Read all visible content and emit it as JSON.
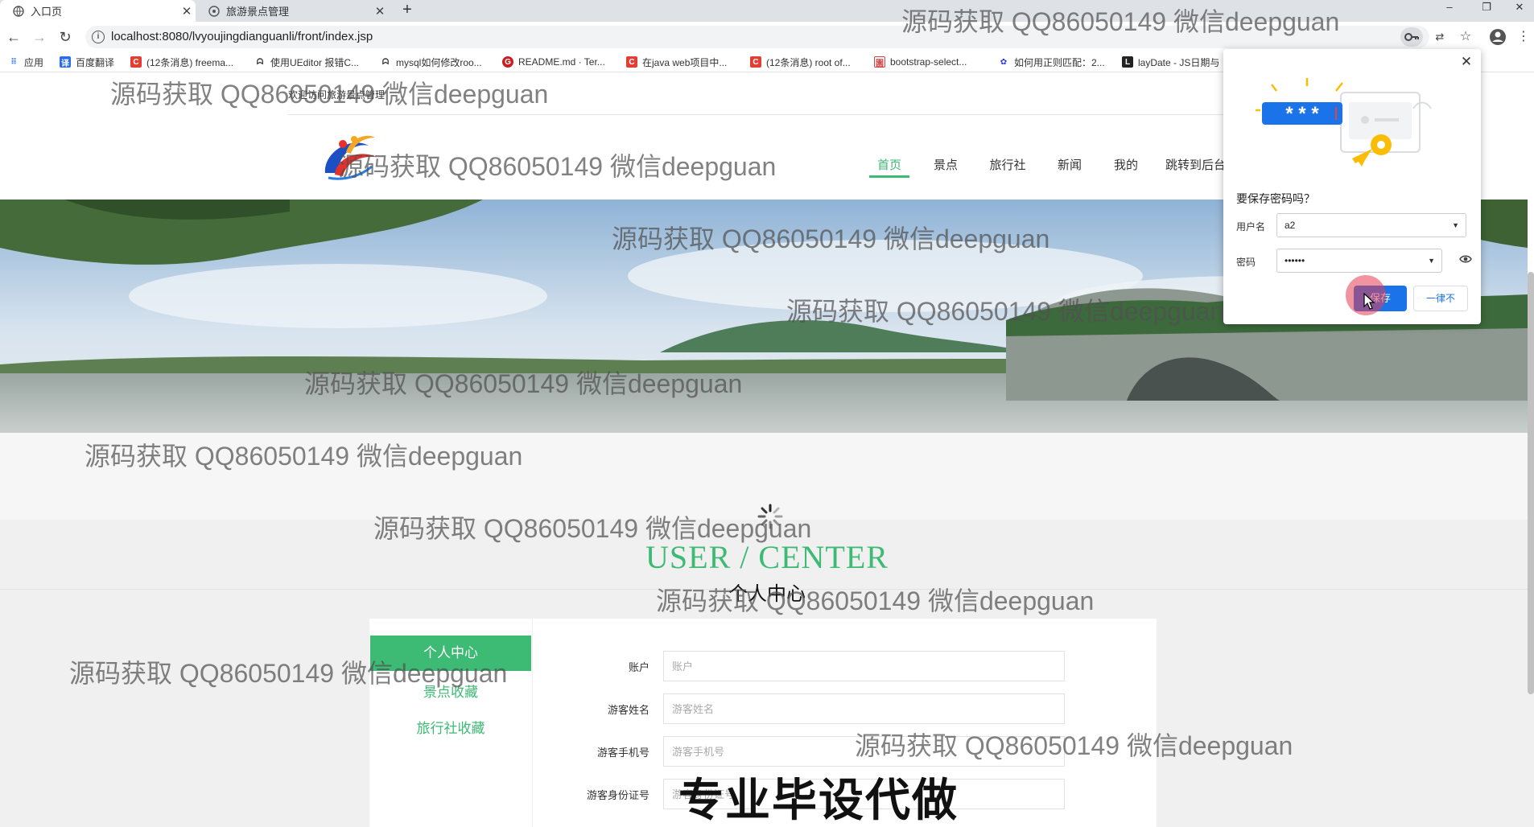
{
  "browser": {
    "tabs": [
      {
        "label": "入口页",
        "active": true,
        "icon": "globe-icon"
      },
      {
        "label": "旅游景点管理",
        "active": false,
        "icon": "globe-icon"
      }
    ],
    "new_tab_label": "+",
    "url": "localhost:8080/lvyoujingdianguanli/front/index.jsp",
    "bookmarks": [
      {
        "label": "应用",
        "icon": "apps-grid-icon"
      },
      {
        "label": "百度翻译",
        "icon": "translate-icon"
      },
      {
        "label": "(12条消息) freema...",
        "icon": "csdn-icon"
      },
      {
        "label": "使用UEditor 报错C...",
        "icon": "fish-icon"
      },
      {
        "label": "mysql如何修改roo...",
        "icon": "fish-icon"
      },
      {
        "label": "README.md · Ter...",
        "icon": "gitee-icon"
      },
      {
        "label": "在java web项目中...",
        "icon": "csdn-icon"
      },
      {
        "label": "(12条消息) root of...",
        "icon": "csdn-icon"
      },
      {
        "label": "bootstrap-select...",
        "icon": "cnblogs-icon"
      },
      {
        "label": "如何用正则匹配：2...",
        "icon": "baidu-paw-icon"
      },
      {
        "label": "layDate - JS日期与",
        "icon": "laydate-icon"
      }
    ]
  },
  "header": {
    "welcome": "欢迎访问旅游景点管理",
    "nav": [
      "首页",
      "景点",
      "旅行社",
      "新闻",
      "我的",
      "跳转到后台"
    ],
    "active_nav": "首页"
  },
  "user_center": {
    "title_en": "USER / CENTER",
    "title_cn": "个人中心",
    "sidebar": [
      "个人中心",
      "景点收藏",
      "旅行社收藏"
    ],
    "fields": [
      {
        "label": "账户",
        "placeholder": "账户"
      },
      {
        "label": "游客姓名",
        "placeholder": "游客姓名"
      },
      {
        "label": "游客手机号",
        "placeholder": "游客手机号"
      },
      {
        "label": "游客身份证号",
        "placeholder": "游客身份证号"
      }
    ]
  },
  "password_popup": {
    "title": "要保存密码吗？",
    "username_label": "用户名",
    "username_value": "a2",
    "password_label": "密码",
    "password_value": "••••••",
    "save_button": "保存",
    "never_button": "一律不"
  },
  "overlays": {
    "watermark": "源码获取 QQ86050149 微信deepguan",
    "ad_text": "专业毕设代做"
  },
  "colors": {
    "accent_green": "#3dba74",
    "chrome_blue": "#1a73e8",
    "tabbar": "#dee1e6"
  }
}
